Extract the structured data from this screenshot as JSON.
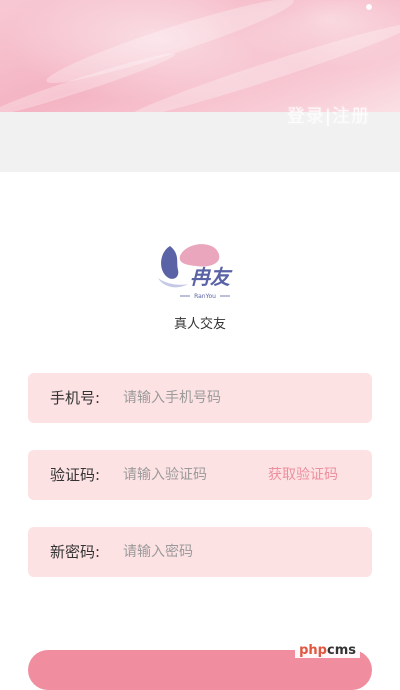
{
  "header": {
    "title": "登录|注册",
    "hero_color": "#f4b3c2"
  },
  "logo": {
    "wordmark": "冉友",
    "subtitle": "RanYou"
  },
  "tagline": "真人交友",
  "form": {
    "phone": {
      "label": "手机号:",
      "placeholder": "请输入手机号码",
      "value": ""
    },
    "code": {
      "label": "验证码:",
      "placeholder": "请输入验证码",
      "value": "",
      "action": "获取验证码"
    },
    "password": {
      "label": "新密码:",
      "placeholder": "请输入密码",
      "value": ""
    },
    "field_bg": "#fde2e4",
    "accent": "#ec8f9e"
  },
  "watermark": {
    "prefix": "php",
    "suffix": "cms"
  }
}
